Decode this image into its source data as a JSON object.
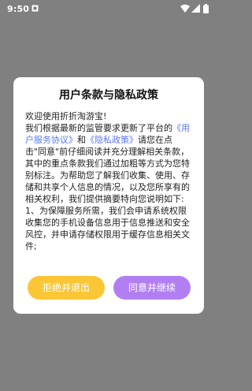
{
  "status_bar": {
    "time": "9:50",
    "icons": [
      "notification-icon",
      "wifi-icon",
      "cellular-signal-icon",
      "battery-icon"
    ]
  },
  "dialog": {
    "title": "用户条款与隐私政策",
    "body": {
      "greeting": "欢迎使用折折淘游宝!",
      "p1_before_link1": "我们根据最新的监管要求更新了平台的",
      "link_user_agreement": "《用户服务协议》",
      "p1_and": "和",
      "link_privacy_policy": "《隐私政策》",
      "p1_after_links": "请您在点击\"同意\"前仔细阅读并充分理解相关条款，其中的重点条款我们通过加粗等方式为您特别标注。为帮助您了解我们收集、使用、存储和共享个人信息的情况，以及您所享有的相关权利，我们提供摘要特向您说明如下:",
      "p2": "1、为保障服务所需，我们会申请系统权限收集您的手机设备信息用于信息推送和安全风控，并申请存储权限用于缓存信息相关文件;"
    },
    "decline_label": "拒绝并退出",
    "agree_label": "同意并继续"
  },
  "colors": {
    "overlay": "#808080",
    "link": "#5b78f0",
    "decline_button": "#fbc636",
    "agree_button": "#b27ff3"
  }
}
